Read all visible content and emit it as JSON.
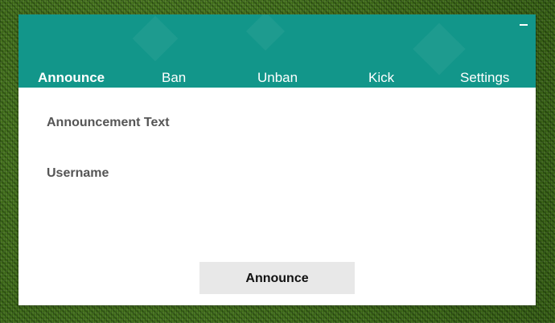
{
  "window": {
    "minimize_icon": "minimize-icon",
    "header_color": "#12968a"
  },
  "tabs": [
    {
      "label": "Announce",
      "active": true
    },
    {
      "label": "Ban",
      "active": false
    },
    {
      "label": "Unban",
      "active": false
    },
    {
      "label": "Kick",
      "active": false
    },
    {
      "label": "Settings",
      "active": false
    }
  ],
  "form": {
    "announcement_text_label": "Announcement Text",
    "announcement_text_value": "",
    "username_label": "Username",
    "username_value": ""
  },
  "actions": {
    "announce_label": "Announce"
  }
}
